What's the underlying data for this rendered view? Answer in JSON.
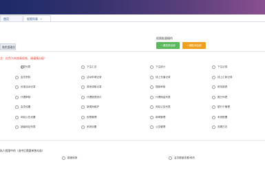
{
  "tabs": [
    {
      "label": "首页"
    },
    {
      "label": "权限列表"
    }
  ],
  "permission_panel": {
    "title": "权限批量操作",
    "select_all_button": "一键选择全部",
    "clear_all_button": "一键取消全部"
  },
  "role_tab": "角色管理员",
  "notice": "注：红色为系统高权限，请谨慎分配！",
  "rows": [
    [
      "",
      "会员列表",
      "下注汇总",
      "下注统计",
      "下注记录"
    ],
    [
      "",
      "会员资料",
      "活动申请记录",
      "线上充值记录",
      "线上汇款记录"
    ],
    [
      "",
      "优惠活动记录",
      "其他领取记录",
      "提款审核",
      "财务报表"
    ],
    [
      "",
      "代理审核",
      "代理报表统计",
      "代理佣金列表",
      "推行列表"
    ],
    [
      "",
      "会员设置",
      "新闻网维护",
      "网站公告列表",
      "银行卡管理"
    ],
    [
      "",
      "网站公告设置",
      "权限管理",
      "新闻管理",
      "系统配置"
    ],
    [
      "",
      "超级网址列表",
      "系统设置",
      "公告管理",
      "查看日志"
    ]
  ],
  "bottom": {
    "title": "私人权限中的（选中后需要单独勾选）",
    "items": [
      "额度转换",
      "会员额度查看/修改"
    ]
  }
}
